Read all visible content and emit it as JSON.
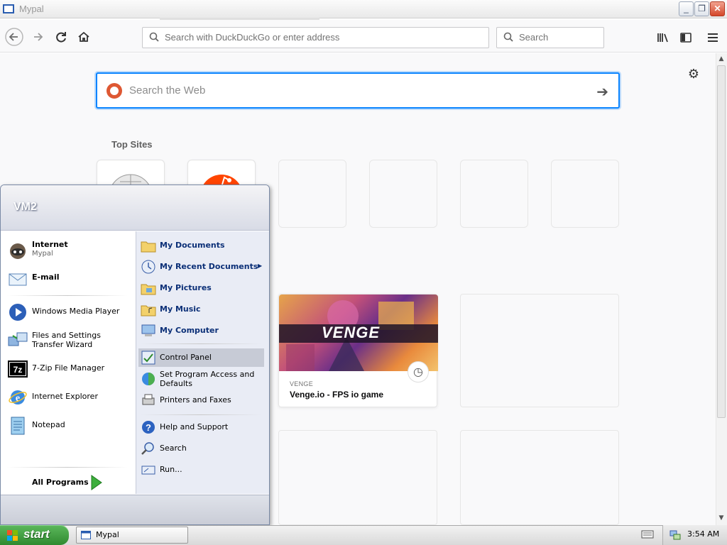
{
  "window": {
    "title": "Mypal",
    "minimize_icon": "minimize-icon",
    "restore_icon": "restore-icon",
    "close_icon": "close-icon"
  },
  "toolbar": {
    "back_icon": "back-arrow-icon",
    "forward_icon": "forward-arrow-icon",
    "reload_icon": "reload-icon",
    "home_icon": "home-icon",
    "url_placeholder": "Search with DuckDuckGo or enter address",
    "search_placeholder": "Search",
    "library_icon": "library-icon",
    "sidebar_icon": "sidebar-icon",
    "menu_icon": "hamburger-menu-icon"
  },
  "newtab": {
    "settings_icon": "gear-icon",
    "websearch_placeholder": "Search the Web",
    "websearch_go_icon": "arrow-right-icon",
    "top_sites_title": "Top Sites",
    "top_sites": [
      {
        "icon": "wikipedia-globe-icon"
      },
      {
        "icon": "reddit-icon"
      },
      {
        "icon": ""
      },
      {
        "icon": ""
      },
      {
        "icon": ""
      },
      {
        "icon": ""
      }
    ],
    "highlight": {
      "logo_text": "VENGE",
      "source": "VENGE",
      "title": "Venge.io - FPS io game",
      "clock_icon": "clock-icon"
    }
  },
  "start_menu": {
    "user": "VM2",
    "pinned": [
      {
        "label": "Internet",
        "sub": "Mypal",
        "icon": "mypal-raccoon-icon"
      },
      {
        "label": "E-mail",
        "sub": "",
        "icon": "email-envelope-icon"
      }
    ],
    "recent": [
      {
        "label": "Windows Media Player",
        "icon": "media-player-icon"
      },
      {
        "label": "Files and Settings Transfer Wizard",
        "icon": "transfer-wizard-icon"
      },
      {
        "label": "7-Zip File Manager",
        "icon": "7zip-icon"
      },
      {
        "label": "Internet Explorer",
        "icon": "internet-explorer-icon"
      },
      {
        "label": "Notepad",
        "icon": "notepad-icon"
      }
    ],
    "all_programs": "All Programs",
    "places": [
      {
        "label": "My Documents",
        "icon": "folder-documents-icon"
      },
      {
        "label": "My Recent Documents",
        "icon": "recent-documents-icon"
      },
      {
        "label": "My Pictures",
        "icon": "folder-pictures-icon"
      },
      {
        "label": "My Music",
        "icon": "folder-music-icon"
      },
      {
        "label": "My Computer",
        "icon": "computer-icon"
      }
    ],
    "system": [
      {
        "label": "Control Panel",
        "icon": "control-panel-icon"
      },
      {
        "label": "Set Program Access and Defaults",
        "icon": "program-defaults-icon"
      },
      {
        "label": "Printers and Faxes",
        "icon": "printer-icon"
      }
    ],
    "help": [
      {
        "label": "Help and Support",
        "icon": "help-icon"
      },
      {
        "label": "Search",
        "icon": "search-magnifier-icon"
      },
      {
        "label": "Run...",
        "icon": "run-icon"
      }
    ]
  },
  "taskbar": {
    "start_label": "start",
    "task_label": "Mypal",
    "clock": "3:54 AM"
  }
}
